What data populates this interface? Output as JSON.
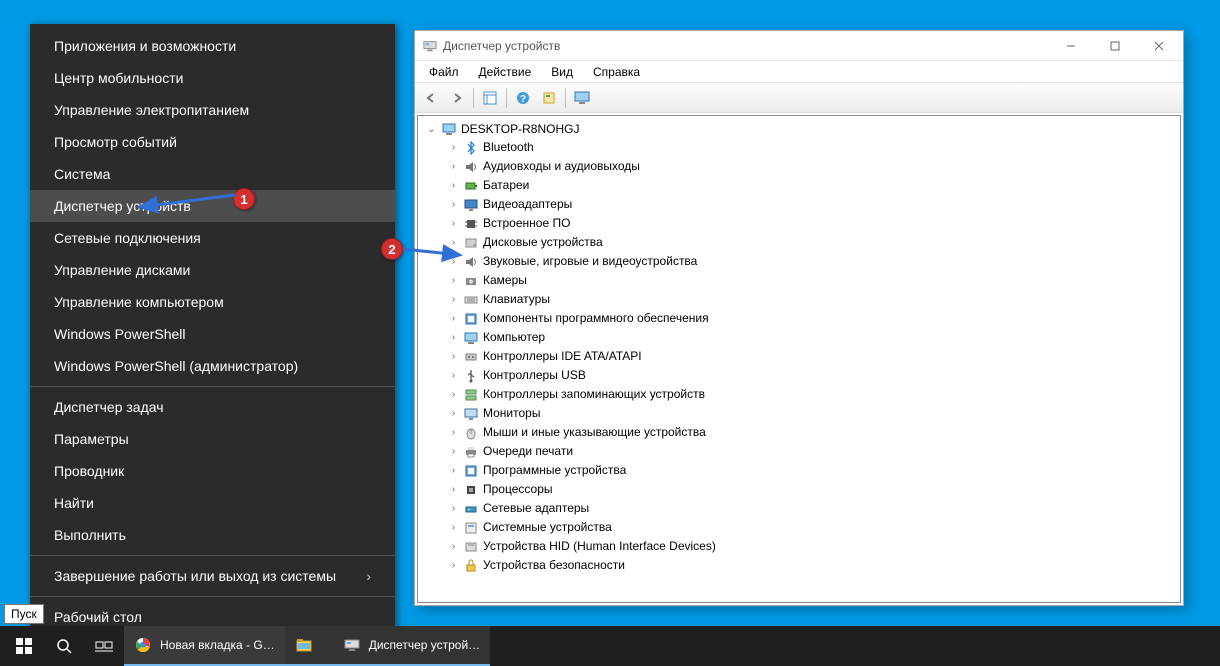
{
  "context_menu": {
    "groups": [
      [
        "Приложения и возможности",
        "Центр мобильности",
        "Управление электропитанием",
        "Просмотр событий",
        "Система",
        "Диспетчер устройств",
        "Сетевые подключения",
        "Управление дисками",
        "Управление компьютером",
        "Windows PowerShell",
        "Windows PowerShell (администратор)"
      ],
      [
        "Диспетчер задач",
        "Параметры",
        "Проводник",
        "Найти",
        "Выполнить"
      ],
      [
        "Завершение работы или выход из системы"
      ],
      [
        "Рабочий стол"
      ]
    ],
    "highlighted": "Диспетчер устройств",
    "submenu_on": "Завершение работы или выход из системы"
  },
  "device_manager": {
    "title": "Диспетчер устройств",
    "menus": [
      "Файл",
      "Действие",
      "Вид",
      "Справка"
    ],
    "toolbar_icons": [
      "nav-back-icon",
      "nav-forward-icon",
      "view-tree-icon",
      "help-icon",
      "properties-icon",
      "monitor-icon"
    ],
    "root": "DESKTOP-R8NOHGJ",
    "categories": [
      {
        "label": "Bluetooth",
        "icon": "bluetooth"
      },
      {
        "label": "Аудиовходы и аудиовыходы",
        "icon": "audio"
      },
      {
        "label": "Батареи",
        "icon": "battery"
      },
      {
        "label": "Видеоадаптеры",
        "icon": "display"
      },
      {
        "label": "Встроенное ПО",
        "icon": "chip"
      },
      {
        "label": "Дисковые устройства",
        "icon": "disk"
      },
      {
        "label": "Звуковые, игровые и видеоустройства",
        "icon": "audio"
      },
      {
        "label": "Камеры",
        "icon": "camera"
      },
      {
        "label": "Клавиатуры",
        "icon": "keyboard"
      },
      {
        "label": "Компоненты программного обеспечения",
        "icon": "sw"
      },
      {
        "label": "Компьютер",
        "icon": "computer"
      },
      {
        "label": "Контроллеры IDE ATA/ATAPI",
        "icon": "ide"
      },
      {
        "label": "Контроллеры USB",
        "icon": "usb"
      },
      {
        "label": "Контроллеры запоминающих устройств",
        "icon": "storage"
      },
      {
        "label": "Мониторы",
        "icon": "monitor"
      },
      {
        "label": "Мыши и иные указывающие устройства",
        "icon": "mouse"
      },
      {
        "label": "Очереди печати",
        "icon": "printer"
      },
      {
        "label": "Программные устройства",
        "icon": "sw"
      },
      {
        "label": "Процессоры",
        "icon": "cpu"
      },
      {
        "label": "Сетевые адаптеры",
        "icon": "network"
      },
      {
        "label": "Системные устройства",
        "icon": "system"
      },
      {
        "label": "Устройства HID (Human Interface Devices)",
        "icon": "hid"
      },
      {
        "label": "Устройства безопасности",
        "icon": "security"
      }
    ]
  },
  "markers": {
    "m1": "1",
    "m2": "2"
  },
  "taskbar": {
    "tooltip": "Пуск",
    "entries": [
      {
        "label": "Новая вкладка - G…",
        "icon": "chrome",
        "active": true
      },
      {
        "label": "",
        "icon": "explorer",
        "active": false
      },
      {
        "label": "Диспетчер устрой…",
        "icon": "devmgr",
        "active": false
      }
    ]
  }
}
